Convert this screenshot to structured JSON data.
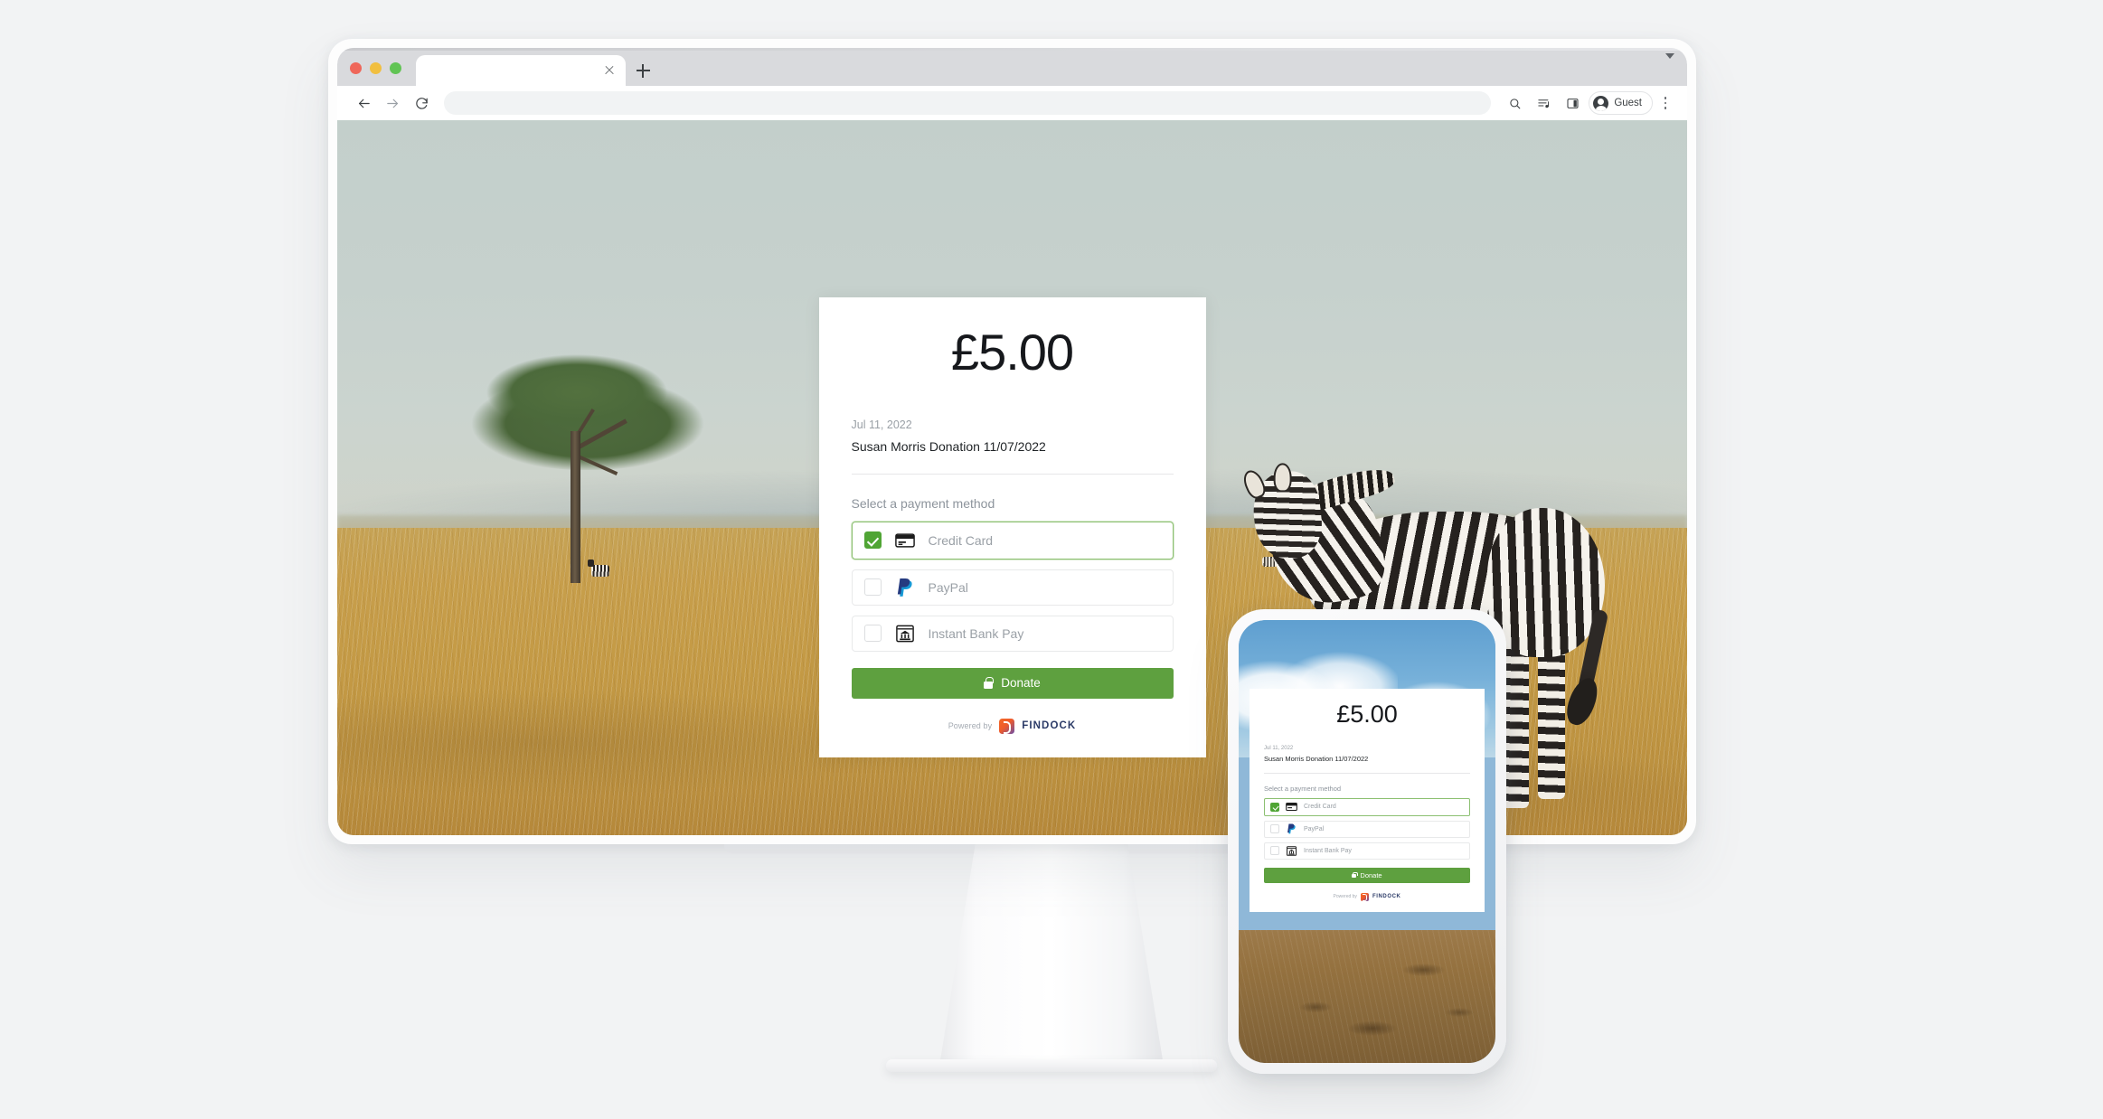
{
  "browser": {
    "tab": {
      "title": "",
      "close_icon": "close-icon"
    },
    "new_tab_icon": "plus-icon",
    "tab_list_chevron_icon": "chevron-down-icon",
    "traffic_lights": [
      "close-red",
      "minimize-yellow",
      "maximize-green"
    ],
    "nav": {
      "back_icon": "back-arrow-icon",
      "forward_icon": "forward-arrow-icon",
      "reload_icon": "reload-icon"
    },
    "address_bar": {
      "value": "",
      "placeholder": ""
    },
    "toolbar_icons": [
      "search-icon",
      "reading-list-icon",
      "side-panel-icon"
    ],
    "profile": {
      "name": "Guest",
      "avatar_icon": "person-avatar-icon"
    },
    "menu_icon": "kebab-menu-icon"
  },
  "checkout": {
    "amount": "£5.00",
    "date": "Jul 11, 2022",
    "description": "Susan Morris Donation 11/07/2022",
    "section_label": "Select a payment method",
    "payment_methods": [
      {
        "label": "Credit Card",
        "icon": "credit-card-icon",
        "selected": true
      },
      {
        "label": "PayPal",
        "icon": "paypal-icon",
        "selected": false
      },
      {
        "label": "Instant Bank Pay",
        "icon": "bank-icon",
        "selected": false
      }
    ],
    "donate_button": {
      "label": "Donate",
      "icon": "lock-icon"
    },
    "footer": {
      "powered_by": "Powered by",
      "brand": "FINDOCK",
      "brand_icon": "findock-logo-icon"
    }
  },
  "colors": {
    "brand_green": "#5ea03f",
    "checkbox_green": "#50a535",
    "selected_border": "#8cc071",
    "paypal_dark": "#253b80",
    "paypal_light": "#179bd7",
    "findock_navy": "#2b3a67",
    "findock_orange": "#f26a28",
    "findock_purple": "#6b4fa8",
    "page_background": "#f2f3f4"
  }
}
